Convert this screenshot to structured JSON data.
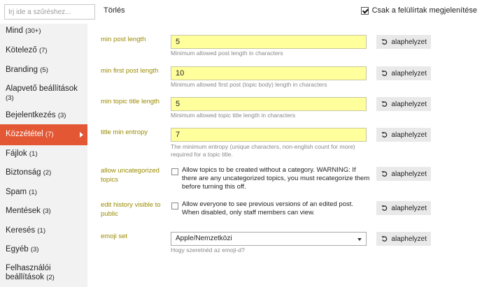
{
  "toolbar": {
    "filter_placeholder": "Írj ide a szűréshez...",
    "clear_label": "Törlés",
    "only_overridden_label": "Csak a felülírtak megjelenítése"
  },
  "sidebar": {
    "items": [
      {
        "label": "Mind",
        "count": "(30+)"
      },
      {
        "label": "Kötelező",
        "count": "(7)"
      },
      {
        "label": "Branding",
        "count": "(5)"
      },
      {
        "label": "Alapvető beállítások",
        "count": "(3)"
      },
      {
        "label": "Bejelentkezés",
        "count": "(3)"
      },
      {
        "label": "Közzététel",
        "count": "(7)"
      },
      {
        "label": "Fájlok",
        "count": "(1)"
      },
      {
        "label": "Biztonság",
        "count": "(2)"
      },
      {
        "label": "Spam",
        "count": "(1)"
      },
      {
        "label": "Mentések",
        "count": "(3)"
      },
      {
        "label": "Keresés",
        "count": "(1)"
      },
      {
        "label": "Egyéb",
        "count": "(3)"
      },
      {
        "label": "Felhasználói beállítások",
        "count": "(2)"
      }
    ]
  },
  "settings": {
    "reset_label": "alaphelyzet",
    "min_post_length": {
      "label": "min post length",
      "value": "5",
      "help": "Minimum allowed post length in characters"
    },
    "min_first_post_length": {
      "label": "min first post length",
      "value": "10",
      "help": "Minimum allowed first post (topic body) length in characters"
    },
    "min_topic_title_length": {
      "label": "min topic title length",
      "value": "5",
      "help": "Minimum allowed topic title length in characters"
    },
    "title_min_entropy": {
      "label": "title min entropy",
      "value": "7",
      "help": "The minimum entropy (unique characters, non-english count for more) required for a topic title."
    },
    "allow_uncategorized_topics": {
      "label": "allow uncategorized topics",
      "text": "Allow topics to be created without a category. WARNING: If there are any uncategorized topics, you must recategorize them before turning this off."
    },
    "edit_history_visible_to_public": {
      "label": "edit history visible to public",
      "text": "Allow everyone to see previous versions of an edited post. When disabled, only staff members can view."
    },
    "emoji_set": {
      "label": "emoji set",
      "value": "Apple/Nemzetközi",
      "help": "Hogy szeretnéd az emoji-d?"
    }
  },
  "colors": {
    "accent": "#e45735",
    "input_bg": "#ffff9b",
    "label": "#9a8a00",
    "sidebar_bg": "#f2f2f2"
  }
}
